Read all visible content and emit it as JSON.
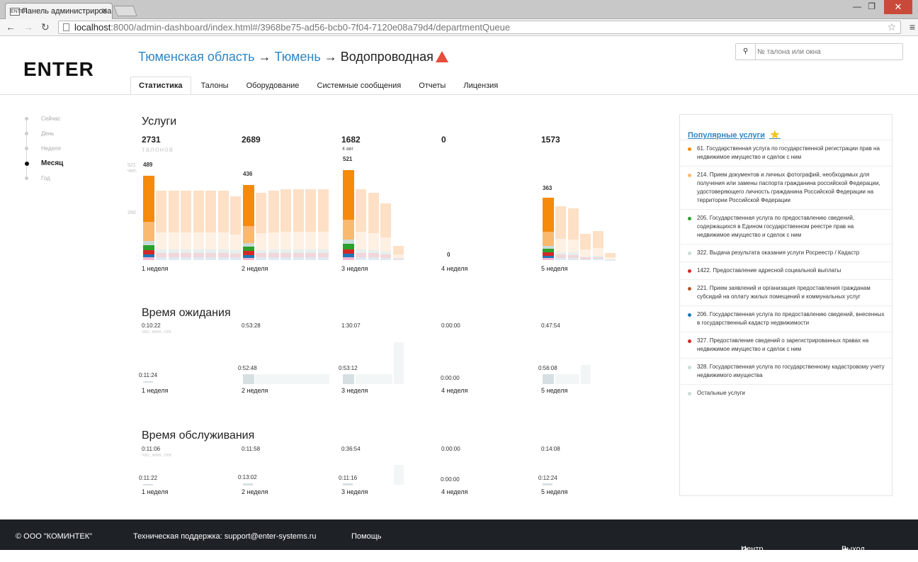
{
  "browser": {
    "tab_title": "Панель администрирова",
    "tab_close": "✕",
    "url_host": "localhost",
    "url_rest": ":8000/admin-dashboard/index.html#/3968be75-ad56-bcb0-7f04-7120e08a79d4/departmentQueue",
    "favicon_text": "ENTER"
  },
  "header": {
    "logo": "ENTER",
    "crumbs": [
      "Тюменская область",
      "Тюмень",
      "Водопроводная"
    ],
    "arrow": "→",
    "search_placeholder": "№ талона или окна"
  },
  "tabs": [
    "Статистика",
    "Талоны",
    "Оборудование",
    "Системные сообщения",
    "Отчеты",
    "Лицензия"
  ],
  "periods": [
    "Сейчас",
    "День",
    "Неделя",
    "Месяц",
    "Год"
  ],
  "active_period": "Месяц",
  "services": {
    "title": "Услуги",
    "totals": [
      "2731",
      "2689",
      "1682",
      "0",
      "1573"
    ],
    "unit": "талонов",
    "date_note": "4 авг",
    "axis": [
      "521",
      "чел.",
      "260"
    ],
    "peaks": [
      "489",
      "436",
      "521",
      "0",
      "363"
    ],
    "weeks": [
      "1 неделя",
      "2 неделя",
      "3 неделя",
      "4 неделя",
      "5 неделя"
    ]
  },
  "wait": {
    "title": "Время ожидания",
    "totals": [
      "0:10:22",
      "0:53:28",
      "1:30:07",
      "0:00:00",
      "0:47:54"
    ],
    "unit": "час, мин, сек",
    "first": [
      "0:11:24",
      "0:52:48",
      "0:53:12",
      "0:00:00",
      "0:56:08"
    ],
    "weeks": [
      "1 неделя",
      "2 неделя",
      "3 неделя",
      "4 неделя",
      "5 неделя"
    ]
  },
  "service_time": {
    "title": "Время обслуживания",
    "totals": [
      "0:11:06",
      "0:11:58",
      "0:36:54",
      "0:00:00",
      "0:14:08"
    ],
    "unit": "час, мин, сек",
    "first": [
      "0:11:22",
      "0:13:02",
      "0:11:16",
      "0:00:00",
      "0:12:24"
    ],
    "weeks": [
      "1 неделя",
      "2 неделя",
      "3 неделя",
      "4 неделя",
      "5 неделя"
    ]
  },
  "popular": {
    "title": "Популярные услуги",
    "items": [
      {
        "text": "61. Государственная услуга по государственной регистрации прав на недвижимое имущество и сделок с ним",
        "color": "#f58a0b"
      },
      {
        "text": "214. Прием документов и личных фотографий, необходимых для получения или замены паспорта гражданина российской Федерации, удостоверяющего личность гражданина Российской Федерации на территории Российской Федерации",
        "color": "#f9b96e"
      },
      {
        "text": "205. Государственная услуга по предоставлению сведений, содержащихся в Едином государственном реестре прав на недвижимое имущество и сделок с ним",
        "color": "#2ca02c"
      },
      {
        "text": "322. Выдача результата оказания услуги Росреестр / Кадастр",
        "color": "#c9dbd8"
      },
      {
        "text": "1422. Предоставление адресной социальной выплаты",
        "color": "#d62728"
      },
      {
        "text": "221. Прием заявлений и организация предоставления гражданам субсидий на оплату жилых помещений и коммунальных услуг",
        "color": "#b5562a"
      },
      {
        "text": "206. Государственная услуга по предоставлению сведений, внесенных в государственный кадастр недвижимости",
        "color": "#1f77b4"
      },
      {
        "text": "327. Предоставление сведений о зарегистрированных правах на недвижимое имущество и сделок с ним",
        "color": "#d62728"
      },
      {
        "text": "328. Государственная услуга по государственному кадастровому учету недвижимого имущества",
        "color": "#c9dbd8"
      },
      {
        "text": "Остальные услуги",
        "color": "#c9dbd8"
      }
    ]
  },
  "footer": {
    "company": "© ООО \"КОМИНТЕК\"",
    "support": "Техническая поддержка: support@enter-systems.ru",
    "help": "Помощь",
    "settings": "Центр настройки",
    "logout": "Выход"
  },
  "chart_data": [
    {
      "type": "bar",
      "title": "Услуги",
      "categories": [
        "1 неделя",
        "2 неделя",
        "3 неделя",
        "4 неделя",
        "5 неделя"
      ],
      "values": [
        2731,
        2689,
        1682,
        0,
        1573
      ],
      "first_bar_values": [
        489,
        436,
        521,
        0,
        363
      ],
      "ylim": [
        0,
        521
      ],
      "ylabel": "чел."
    },
    {
      "type": "bar",
      "title": "Время ожидания",
      "categories": [
        "1 неделя",
        "2 неделя",
        "3 неделя",
        "4 неделя",
        "5 неделя"
      ],
      "values": [
        "0:10:22",
        "0:53:28",
        "1:30:07",
        "0:00:00",
        "0:47:54"
      ]
    },
    {
      "type": "bar",
      "title": "Время обслуживания",
      "categories": [
        "1 неделя",
        "2 неделя",
        "3 неделя",
        "4 неделя",
        "5 неделя"
      ],
      "values": [
        "0:11:06",
        "0:11:58",
        "0:36:54",
        "0:00:00",
        "0:14:08"
      ]
    }
  ]
}
